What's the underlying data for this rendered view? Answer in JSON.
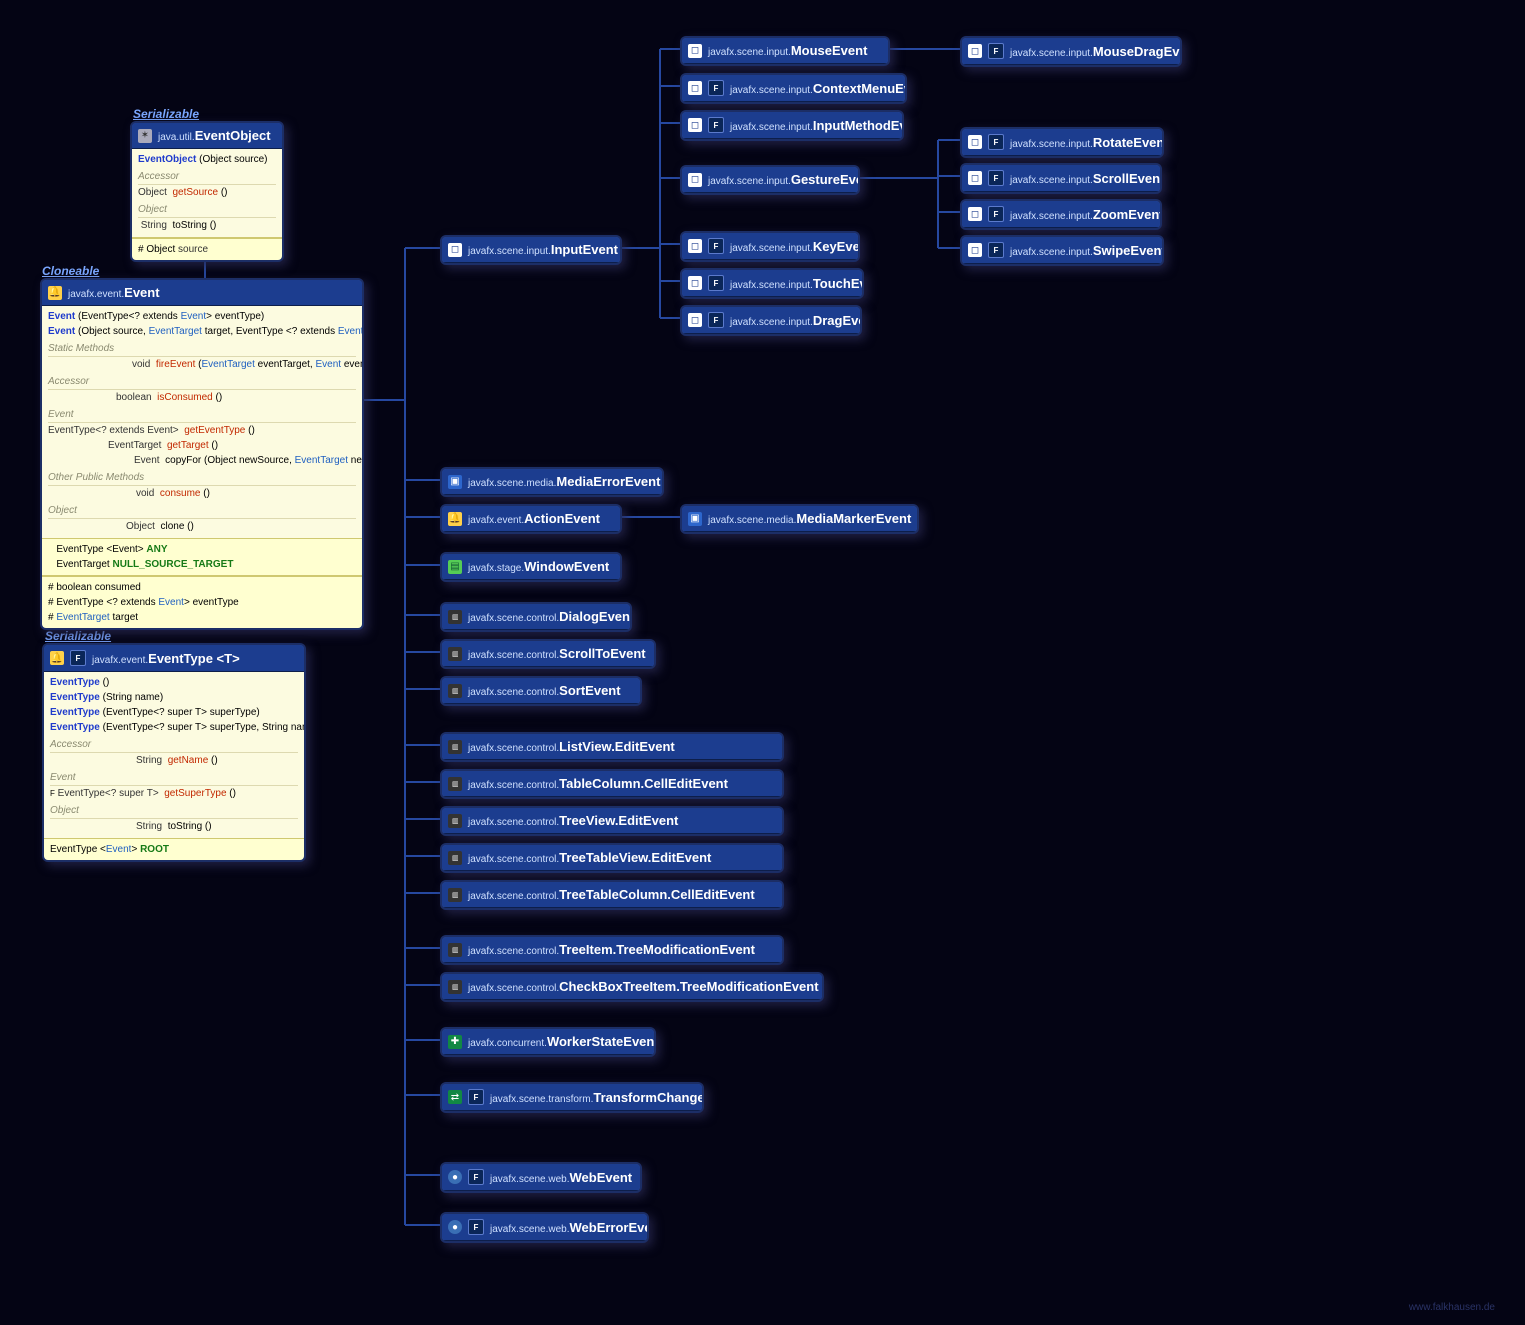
{
  "tags": {
    "serializable1": "Serializable",
    "cloneable": "Cloneable",
    "serializable2": "Serializable"
  },
  "eventObject": {
    "pkg": "java.util.",
    "name": "EventObject",
    "ctor": {
      "sig": "(Object source)"
    },
    "accessor_label": "Accessor",
    "m_getSource": {
      "ret": "Object",
      "name": "getSource",
      "sig": " ()"
    },
    "object_label": "Object",
    "m_toString": {
      "ret": "String",
      "name": "toString",
      "sig": " ()"
    },
    "field": {
      "vis": "#",
      "type": "Object",
      "name": "source"
    }
  },
  "event": {
    "pkg": "javafx.event.",
    "name": "Event",
    "ctor1": "Event (EventType<? extends Event> eventType)",
    "ctor2": "Event (Object source, EventTarget target, EventType <? extends Event> eventType)",
    "static_label": "Static Methods",
    "m_fireEvent": {
      "ret": "void",
      "name": "fireEvent",
      "sig": " (EventTarget eventTarget, Event event)"
    },
    "accessor_label": "Accessor",
    "m_isConsumed": {
      "ret": "boolean",
      "name": "isConsumed",
      "sig": " ()"
    },
    "event_label": "Event",
    "m_getEventType": {
      "ret": "EventType<? extends Event>",
      "name": "getEventType",
      "sig": " ()"
    },
    "m_getTarget": {
      "ret": "EventTarget",
      "name": "getTarget",
      "sig": " ()"
    },
    "m_copyFor": {
      "ret": "Event",
      "name": "copyFor",
      "sig": " (Object newSource, EventTarget newTarget)"
    },
    "other_label": "Other Public Methods",
    "m_consume": {
      "ret": "void",
      "name": "consume",
      "sig": " ()"
    },
    "object_label": "Object",
    "m_clone": {
      "ret": "Object",
      "name": "clone",
      "sig": " ()"
    },
    "const_any": {
      "type": "EventType <Event>",
      "name": "ANY"
    },
    "const_null": {
      "type": "EventTarget",
      "name": "NULL_SOURCE_TARGET"
    },
    "f_consumed": {
      "vis": "#",
      "type": "boolean",
      "name": "consumed"
    },
    "f_eventType": {
      "vis": "#",
      "type": "EventType <? extends Event>",
      "name": "eventType"
    },
    "f_target": {
      "vis": "#",
      "type": "EventTarget",
      "name": "target"
    }
  },
  "eventType": {
    "pkg": "javafx.event.",
    "name": "EventType <T>",
    "ctor1": "EventType ()",
    "ctor2": "EventType (String name)",
    "ctor3": "EventType (EventType<? super T> superType)",
    "ctor4": "EventType (EventType<? super T> superType, String name)",
    "accessor_label": "Accessor",
    "m_getName": {
      "ret": "String",
      "name": "getName",
      "sig": " ()"
    },
    "event_label": "Event",
    "m_getSuperType": {
      "ret": "EventType<? super T>",
      "name": "getSuperType",
      "sig": " ()"
    },
    "object_label": "Object",
    "m_toString": {
      "ret": "String",
      "name": "toString",
      "sig": " ()"
    },
    "const_root": {
      "type": "EventType <Event>",
      "name": "ROOT"
    }
  },
  "simple": {
    "inputEvent": {
      "pkg": "javafx.scene.input.",
      "name": "InputEvent"
    },
    "mouseEvent": {
      "pkg": "javafx.scene.input.",
      "name": "MouseEvent"
    },
    "mouseDrag": {
      "pkg": "javafx.scene.input.",
      "name": "MouseDragEvent"
    },
    "ctxMenu": {
      "pkg": "javafx.scene.input.",
      "name": "ContextMenuEvent"
    },
    "inputMethod": {
      "pkg": "javafx.scene.input.",
      "name": "InputMethodEvent"
    },
    "gesture": {
      "pkg": "javafx.scene.input.",
      "name": "GestureEvent"
    },
    "rotate": {
      "pkg": "javafx.scene.input.",
      "name": "RotateEvent"
    },
    "scroll": {
      "pkg": "javafx.scene.input.",
      "name": "ScrollEvent"
    },
    "zoom": {
      "pkg": "javafx.scene.input.",
      "name": "ZoomEvent"
    },
    "swipe": {
      "pkg": "javafx.scene.input.",
      "name": "SwipeEvent"
    },
    "key": {
      "pkg": "javafx.scene.input.",
      "name": "KeyEvent"
    },
    "touch": {
      "pkg": "javafx.scene.input.",
      "name": "TouchEvent"
    },
    "drag": {
      "pkg": "javafx.scene.input.",
      "name": "DragEvent"
    },
    "mediaError": {
      "pkg": "javafx.scene.media.",
      "name": "MediaErrorEvent"
    },
    "action": {
      "pkg": "javafx.event.",
      "name": "ActionEvent"
    },
    "mediaMarker": {
      "pkg": "javafx.scene.media.",
      "name": "MediaMarkerEvent"
    },
    "window": {
      "pkg": "javafx.stage.",
      "name": "WindowEvent"
    },
    "dialog": {
      "pkg": "javafx.scene.control.",
      "name": "DialogEvent"
    },
    "scrollTo": {
      "pkg": "javafx.scene.control.",
      "name": "ScrollToEvent <T>"
    },
    "sort": {
      "pkg": "javafx.scene.control.",
      "name": "SortEvent <C>"
    },
    "listEdit": {
      "pkg": "javafx.scene.control.",
      "name": "ListView.EditEvent <T>"
    },
    "tableCell": {
      "pkg": "javafx.scene.control.",
      "name": "TableColumn.CellEditEvent <S, T>"
    },
    "treeEdit": {
      "pkg": "javafx.scene.control.",
      "name": "TreeView.EditEvent <T>"
    },
    "treeTableEdit": {
      "pkg": "javafx.scene.control.",
      "name": "TreeTableView.EditEvent <S>"
    },
    "treeTableCell": {
      "pkg": "javafx.scene.control.",
      "name": "TreeTableColumn.CellEditEvent <S, T>"
    },
    "treeItemMod": {
      "pkg": "javafx.scene.control.",
      "name": "TreeItem.TreeModificationEvent <T>"
    },
    "cbTreeItemMod": {
      "pkg": "javafx.scene.control.",
      "name": "CheckBoxTreeItem.TreeModificationEvent <T>"
    },
    "workerState": {
      "pkg": "javafx.concurrent.",
      "name": "WorkerStateEvent"
    },
    "transform": {
      "pkg": "javafx.scene.transform.",
      "name": "TransformChangedEvent"
    },
    "webEvent": {
      "pkg": "javafx.scene.web.",
      "name": "WebEvent <T>"
    },
    "webError": {
      "pkg": "javafx.scene.web.",
      "name": "WebErrorEvent"
    }
  },
  "credit": "www.falkhausen.de"
}
